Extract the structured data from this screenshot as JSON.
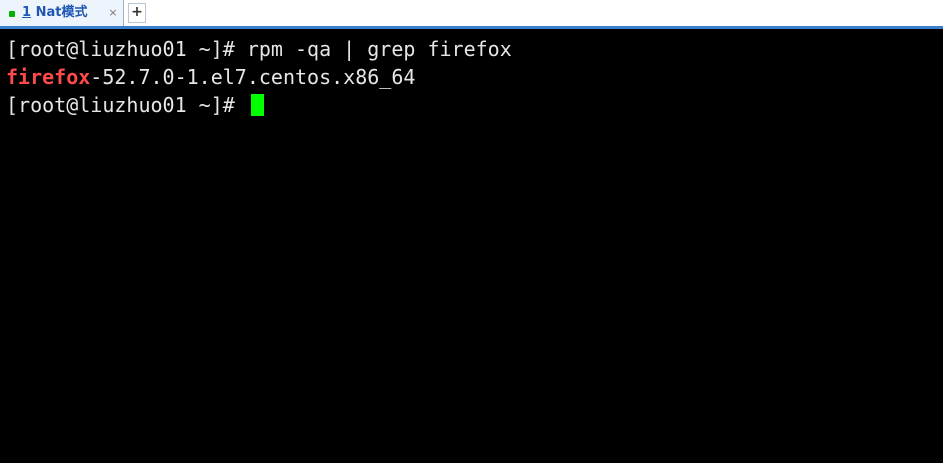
{
  "tabs": [
    {
      "status_color": "#00b400",
      "number": "1",
      "title": "Nat模式",
      "close_glyph": "×",
      "active": true
    }
  ],
  "new_tab_glyph": "+",
  "terminal": {
    "background": "#000000",
    "foreground": "#e6e6e6",
    "highlight_color": "#ff4a4a",
    "cursor_color": "#00ff00",
    "lines": [
      {
        "prompt": "[root@liuzhuo01 ~]# ",
        "command": "rpm -qa | grep firefox"
      },
      {
        "highlight": "firefox",
        "rest": "-52.7.0-1.el7.centos.x86_64"
      },
      {
        "prompt": "[root@liuzhuo01 ~]# ",
        "command": ""
      }
    ]
  }
}
